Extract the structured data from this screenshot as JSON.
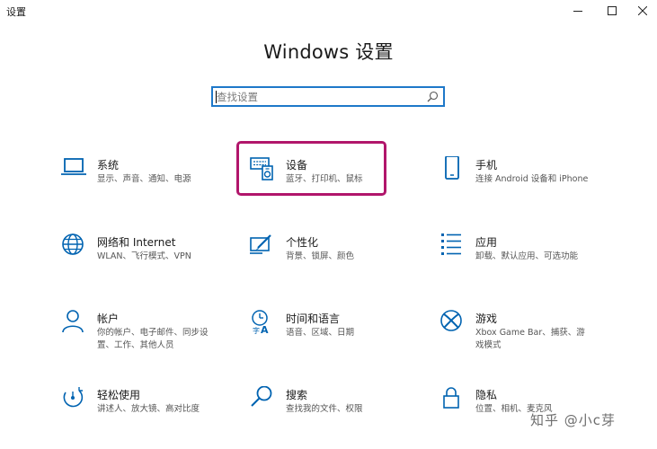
{
  "window": {
    "app_title": "设置"
  },
  "header": {
    "title": "Windows 设置"
  },
  "search": {
    "placeholder": "查找设置"
  },
  "tiles": [
    {
      "name": "系统",
      "desc": "显示、声音、通知、电源",
      "icon": "laptop-icon"
    },
    {
      "name": "设备",
      "desc": "蓝牙、打印机、鼠标",
      "icon": "devices-icon"
    },
    {
      "name": "手机",
      "desc": "连接 Android 设备和 iPhone",
      "icon": "phone-icon"
    },
    {
      "name": "网络和 Internet",
      "desc": "WLAN、飞行模式、VPN",
      "icon": "globe-icon"
    },
    {
      "name": "个性化",
      "desc": "背景、锁屏、颜色",
      "icon": "paint-icon"
    },
    {
      "name": "应用",
      "desc": "卸载、默认应用、可选功能",
      "icon": "apps-list-icon"
    },
    {
      "name": "帐户",
      "desc": "你的帐户、电子邮件、同步设置、工作、其他人员",
      "icon": "person-icon"
    },
    {
      "name": "时间和语言",
      "desc": "语音、区域、日期",
      "icon": "time-language-icon"
    },
    {
      "name": "游戏",
      "desc": "Xbox Game Bar、捕获、游戏模式",
      "icon": "xbox-icon"
    },
    {
      "name": "轻松使用",
      "desc": "讲述人、放大镜、高对比度",
      "icon": "ease-of-access-icon"
    },
    {
      "name": "搜索",
      "desc": "查找我的文件、权限",
      "icon": "search-icon"
    },
    {
      "name": "隐私",
      "desc": "位置、相机、麦克风",
      "icon": "lock-icon"
    }
  ],
  "watermark": "知乎 @小c芽",
  "colors": {
    "accent": "#0063b1",
    "highlight": "#b1166b",
    "search_border": "#1e78c9"
  }
}
